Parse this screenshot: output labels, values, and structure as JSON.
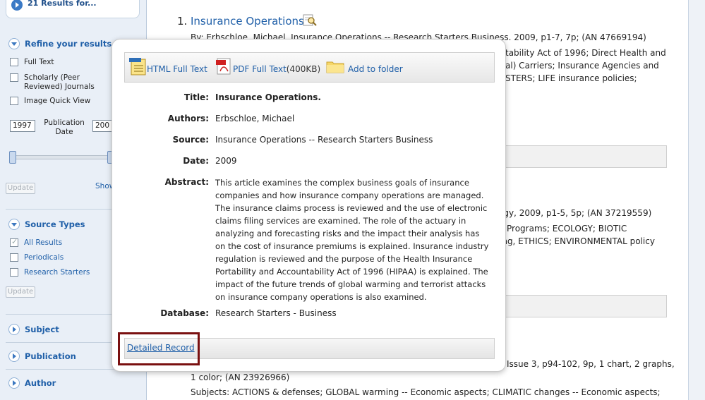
{
  "sidebar": {
    "results_header": "21 Results for...",
    "refine_title": "Refine your results",
    "limiters": [
      {
        "label": "Full Text",
        "checked": false
      },
      {
        "label": "Scholarly (Peer Reviewed) Journals",
        "checked": false
      },
      {
        "label": "Image Quick View",
        "checked": false
      }
    ],
    "pub_date": {
      "label": "Publication Date",
      "from": "1997",
      "to": "200"
    },
    "update_label": "Update",
    "show_label": "Show",
    "source_types_title": "Source Types",
    "source_types": [
      {
        "label": "All Results",
        "checked": true
      },
      {
        "label": "Periodicals",
        "checked": false
      },
      {
        "label": "Research Starters",
        "checked": false
      }
    ],
    "facets": [
      "Subject",
      "Publication",
      "Author"
    ]
  },
  "results": {
    "first": {
      "number": "1.",
      "title": "Insurance Operations.",
      "byline_left": "By: Erbschloe, Michael. Insurance Operations -- Research Starters Business. 2009, p1-7, 7p; (AN 47669194)",
      "bylines_right": [
        "tability Act of 1996; Direct Health and",
        "al) Carriers; Insurance Agencies and",
        "STERS; LIFE insurance policies;"
      ]
    },
    "second_bylines_right": [
      "ogy, 2009, p1-5, 5p; (AN 37219559)",
      "Programs; ECOLOGY; BIOTIC",
      "ing, ETHICS; ENVIRONMENTAL policy"
    ],
    "third_bylines": [
      "Issue 3, p94-102, 9p, 1 chart, 2 graphs,",
      "1 color; (AN 23926966)",
      "Subjects: ACTIONS & defenses; GLOBAL warming -- Economic aspects; CLIMATIC changes -- Economic aspects;"
    ]
  },
  "popup": {
    "toolbar": {
      "html_label": "HTML Full Text",
      "pdf_label": "PDF Full Text",
      "pdf_size": "(400KB)",
      "folder_label": "Add to folder"
    },
    "fields": {
      "title_label": "Title:",
      "title": "Insurance Operations.",
      "authors_label": "Authors:",
      "authors": "Erbschloe, Michael",
      "source_label": "Source:",
      "source": "Insurance Operations -- Research Starters Business",
      "date_label": "Date:",
      "date": "2009",
      "abstract_label": "Abstract:",
      "abstract": "This article examines the complex business goals of insurance companies and how insurance company operations are managed. The insurance claims process is reviewed and the use of electronic claims filing services are examined. The role of the actuary in analyzing and forecasting risks and the impact their analysis has on the cost of insurance premiums is explained. Insurance industry regulation is reviewed and the purpose of the Health Insurance Portability and Accountability Act of 1996 (HIPAA) is explained. The impact of the future trends of global warming and terrorist attacks on insurance company operations is also examined.",
      "database_label": "Database:",
      "database": "Research Starters - Business"
    },
    "detailed_record": "Detailed Record"
  },
  "colors": {
    "link": "#1f5fa8",
    "highlight_box": "#7a1010",
    "sidebar_bg": "#e9eff7"
  }
}
